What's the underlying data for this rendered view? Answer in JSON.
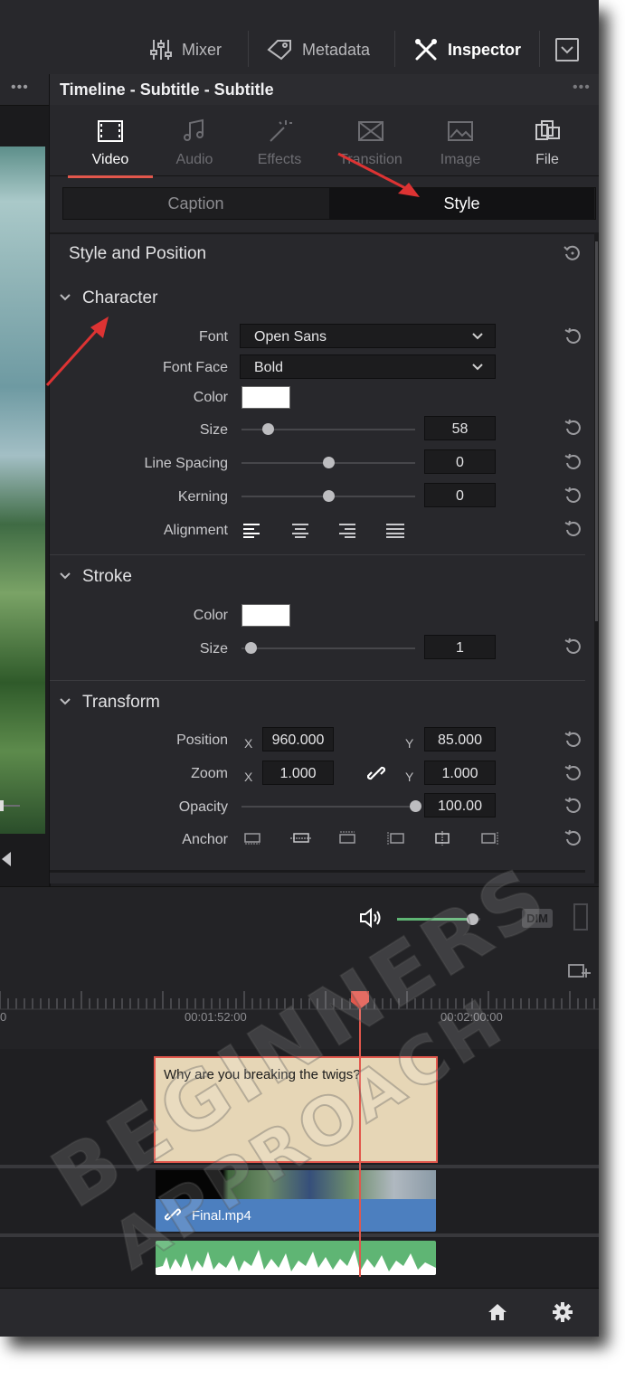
{
  "topbar": {
    "mixer_label": "Mixer",
    "metadata_label": "Metadata",
    "inspector_label": "Inspector"
  },
  "viewer": {
    "menu_dots": "•••"
  },
  "inspector": {
    "title": "Timeline - Subtitle - Subtitle",
    "menu_dots": "•••",
    "tabs": [
      {
        "label": "Video",
        "icon": "film-icon",
        "active": true
      },
      {
        "label": "Audio",
        "icon": "music-note-icon"
      },
      {
        "label": "Effects",
        "icon": "magic-wand-icon"
      },
      {
        "label": "Transition",
        "icon": "transition-icon"
      },
      {
        "label": "Image",
        "icon": "image-icon"
      },
      {
        "label": "File",
        "icon": "file-icon"
      }
    ],
    "subtabs": {
      "caption": "Caption",
      "style": "Style",
      "active": "Style"
    },
    "style_position_title": "Style and Position",
    "character": {
      "title": "Character",
      "font_label": "Font",
      "font_value": "Open Sans",
      "face_label": "Font Face",
      "face_value": "Bold",
      "color_label": "Color",
      "color_value": "#ffffff",
      "size_label": "Size",
      "size_value": "58",
      "size_level": 0.15,
      "line_spacing_label": "Line Spacing",
      "line_spacing_value": "0",
      "line_spacing_level": 0.5,
      "kerning_label": "Kerning",
      "kerning_value": "0",
      "kerning_level": 0.5,
      "alignment_label": "Alignment",
      "alignment_options": [
        "align-left-icon",
        "align-center-icon",
        "align-right-icon",
        "align-justify-icon"
      ]
    },
    "stroke": {
      "title": "Stroke",
      "color_label": "Color",
      "color_value": "#ffffff",
      "size_label": "Size",
      "size_value": "1",
      "size_level": 0.05
    },
    "transform": {
      "title": "Transform",
      "position_label": "Position",
      "position_x": "960.000",
      "position_y": "85.000",
      "zoom_label": "Zoom",
      "zoom_x": "1.000",
      "zoom_y": "1.000",
      "x_label": "X",
      "y_label": "Y",
      "opacity_label": "Opacity",
      "opacity_value": "100.00",
      "opacity_level": 1.0,
      "anchor_label": "Anchor"
    }
  },
  "audio": {
    "dim_label": "DIM",
    "volume_level": 0.9
  },
  "timeline": {
    "tc_left": "0",
    "tc_1": "00:01:52:00",
    "tc_2": "00:02:00:00",
    "subtitle_text": "Why are you breaking the twigs?",
    "video_clip_name": "Final.mp4"
  },
  "watermark": {
    "line1": "BEGINNERS",
    "line2": "APPROACH"
  },
  "colors": {
    "accent": "#e2574c",
    "audio_green": "#5fb574",
    "clip_blue": "#4c7fbf",
    "subtitle_bg": "#e6d6b6"
  }
}
